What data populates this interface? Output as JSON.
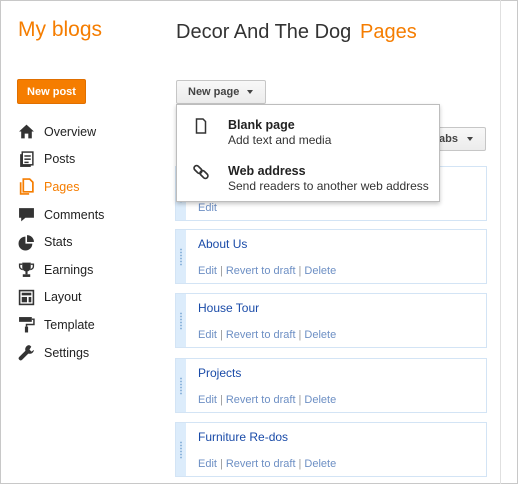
{
  "header": {
    "brand": "My blogs",
    "blog_title": "Decor And The Dog",
    "separator": "·",
    "section": "Pages"
  },
  "sidebar": {
    "new_post_label": "New post",
    "items": [
      {
        "label": "Overview",
        "icon": "home-icon"
      },
      {
        "label": "Posts",
        "icon": "posts-icon"
      },
      {
        "label": "Pages",
        "icon": "pages-icon",
        "active": true
      },
      {
        "label": "Comments",
        "icon": "comment-icon"
      },
      {
        "label": "Stats",
        "icon": "pie-chart-icon"
      },
      {
        "label": "Earnings",
        "icon": "trophy-icon"
      },
      {
        "label": "Layout",
        "icon": "layout-icon"
      },
      {
        "label": "Template",
        "icon": "paint-roller-icon"
      },
      {
        "label": "Settings",
        "icon": "wrench-icon"
      }
    ]
  },
  "toolbar": {
    "new_page_label": "New page",
    "tabs_label": "abs"
  },
  "new_page_menu": {
    "items": [
      {
        "title": "Blank page",
        "description": "Add text and media",
        "icon": "document-icon"
      },
      {
        "title": "Web address",
        "description": "Send readers to another web address",
        "icon": "link-icon"
      }
    ]
  },
  "pages": {
    "first_edit_label": "Edit",
    "list": [
      {
        "title": "About Us",
        "edit": "Edit",
        "revert": "Revert to draft",
        "delete": "Delete"
      },
      {
        "title": "House Tour",
        "edit": "Edit",
        "revert": "Revert to draft",
        "delete": "Delete"
      },
      {
        "title": "Projects",
        "edit": "Edit",
        "revert": "Revert to draft",
        "delete": "Delete"
      },
      {
        "title": "Furniture Re-dos",
        "edit": "Edit",
        "revert": "Revert to draft",
        "delete": "Delete"
      }
    ]
  },
  "colors": {
    "accent": "#f57d00",
    "link": "#1a4ba8",
    "action_link": "#6d8fc4",
    "card_handle": "#dcecfb"
  }
}
